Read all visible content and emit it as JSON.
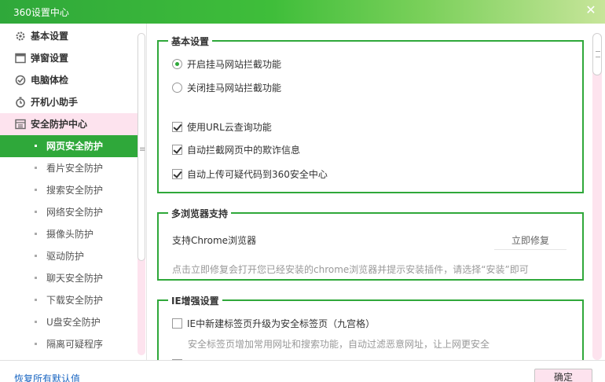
{
  "window": {
    "title": "360设置中心",
    "close_glyph": "✕"
  },
  "sidebar": {
    "categories": [
      {
        "label": "基本设置",
        "icon": "gear-icon"
      },
      {
        "label": "弹窗设置",
        "icon": "window-icon"
      },
      {
        "label": "电脑体检",
        "icon": "checkup-icon"
      },
      {
        "label": "开机小助手",
        "icon": "timer-icon"
      },
      {
        "label": "安全防护中心",
        "icon": "shield-icon"
      }
    ],
    "sub_items": [
      "网页安全防护",
      "看片安全防护",
      "搜索安全防护",
      "网络安全防护",
      "摄像头防护",
      "驱动防护",
      "聊天安全防护",
      "下载安全防护",
      "U盘安全防护",
      "隔离可疑程序"
    ],
    "active_sub_index": 0
  },
  "groups": {
    "basic": {
      "title": "基本设置",
      "radio_on": "开启挂马网站拦截功能",
      "radio_off": "关闭挂马网站拦截功能",
      "check_url": "使用URL云查询功能",
      "check_fraud": "自动拦截网页中的欺诈信息",
      "check_upload": "自动上传可疑代码到360安全中心"
    },
    "multi_browser": {
      "title": "多浏览器支持",
      "chrome_label": "支持Chrome浏览器",
      "fix_button": "立即修复",
      "hint": "点击立即修复会打开您已经安装的chrome浏览器并提示安装插件，请选择“安装”即可"
    },
    "ie": {
      "title": "IE增强设置",
      "check_tab": "IE中新建标签页升级为安全标签页（九宫格）",
      "tab_hint": "安全标签页增加常用网址和搜索功能，自动过滤恶意网址，让上网更安全"
    }
  },
  "footer": {
    "restore_link": "恢复所有默认值",
    "ok_button": "确定"
  },
  "colors": {
    "accent": "#2fa83a",
    "pink": "#fde3ee",
    "link": "#1a66c2"
  }
}
